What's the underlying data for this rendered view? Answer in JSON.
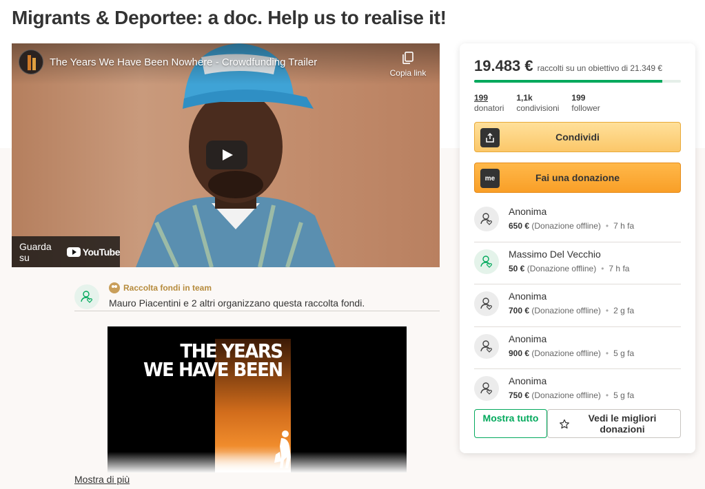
{
  "page": {
    "title": "Migrants & Deportee: a doc. Help us to realise it!"
  },
  "video": {
    "title": "The Years We Have Been Nowhere - Crowdfunding Trailer",
    "copy_link": "Copia link",
    "watch_on": "Guarda su",
    "youtube": "YouTube"
  },
  "organizer": {
    "team_label": "Raccolta fondi in team",
    "text": "Mauro Piacentini e 2 altri organizzano questa raccolta fondi."
  },
  "poster": {
    "line1": "THE YEARS",
    "line2": "WE HAVE BEEN"
  },
  "more_link": "Mostra di più",
  "sidebar": {
    "amount": "19.483 €",
    "goal_text": "raccolti su un obiettivo di 21.349 €",
    "progress_fraction": 0.91,
    "progress_color": "#02a95c",
    "stats": [
      {
        "value": "199",
        "label": "donatori"
      },
      {
        "value": "1,1k",
        "label": "condivisioni"
      },
      {
        "value": "199",
        "label": "follower"
      }
    ],
    "share_label": "Condividi",
    "donate_label": "Fai una donazione",
    "donate_icon_text": "me",
    "donations": [
      {
        "name": "Anonima",
        "amount": "650 €",
        "note": "(Donazione offline)",
        "time": "7 h fa"
      },
      {
        "name": "Massimo Del Vecchio",
        "amount": "50 €",
        "note": "(Donazione offline)",
        "time": "7 h fa"
      },
      {
        "name": "Anonima",
        "amount": "700 €",
        "note": "(Donazione offline)",
        "time": "2 g fa"
      },
      {
        "name": "Anonima",
        "amount": "900 €",
        "note": "(Donazione offline)",
        "time": "5 g fa"
      },
      {
        "name": "Anonima",
        "amount": "750 €",
        "note": "(Donazione offline)",
        "time": "5 g fa"
      }
    ],
    "show_all_label": "Mostra tutto",
    "top_donations_label": "Vedi le migliori donazioni"
  }
}
